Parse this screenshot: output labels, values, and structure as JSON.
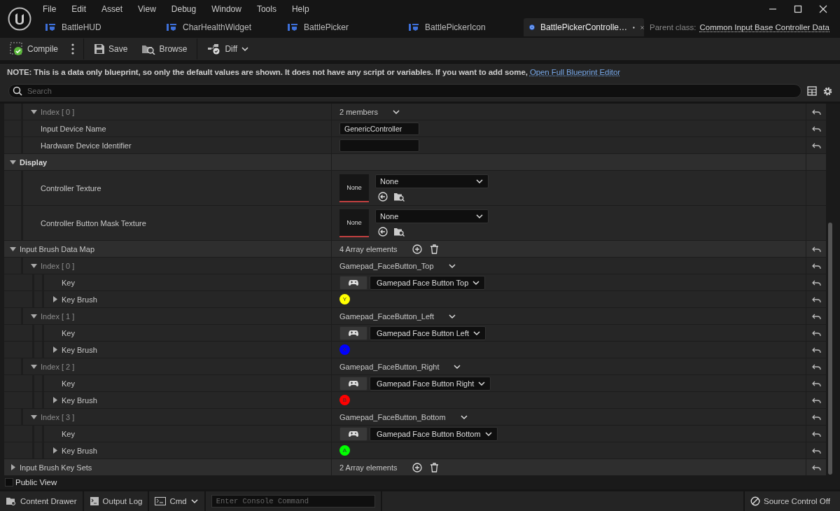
{
  "menu": [
    "File",
    "Edit",
    "Asset",
    "View",
    "Debug",
    "Window",
    "Tools",
    "Help"
  ],
  "tabs": [
    {
      "label": "BattleHUD",
      "kind": "widget",
      "selected": false,
      "modified": false
    },
    {
      "label": "CharHealthWidget",
      "kind": "widget",
      "selected": false,
      "modified": false
    },
    {
      "label": "BattlePicker",
      "kind": "widget",
      "selected": false,
      "modified": false
    },
    {
      "label": "BattlePickerIcon",
      "kind": "widget",
      "selected": false,
      "modified": false
    },
    {
      "label": "BattlePickerControlle…",
      "kind": "data",
      "selected": true,
      "modified": true
    }
  ],
  "parent_class": {
    "label": "Parent class:",
    "link": "Common Input Base Controller Data"
  },
  "toolbar": [
    {
      "kind": "compile",
      "label": "Compile"
    },
    {
      "kind": "more"
    },
    {
      "kind": "save",
      "label": "Save"
    },
    {
      "kind": "browse",
      "label": "Browse"
    },
    {
      "kind": "diff",
      "label": "Diff"
    }
  ],
  "notice": {
    "text": "NOTE: This is a data only blueprint, so only the default values are shown.  It does not have any script or variables.  If you want to add some, ",
    "link": "Open Full Blueprint Editor"
  },
  "search": {
    "placeholder": "Search"
  },
  "properties": [
    {
      "kind": "struct",
      "label": "Index [ 0 ]",
      "continues_above": true,
      "expanded": true,
      "value": "2 members",
      "resettable": true,
      "children": [
        {
          "kind": "text",
          "label": "Input Device Name",
          "value": "GenericController",
          "resettable": true
        },
        {
          "kind": "text",
          "label": "Hardware Device Identifier",
          "resettable": true
        }
      ]
    },
    {
      "kind": "category",
      "label": "Display",
      "expanded": true,
      "resettable": false,
      "children": [
        {
          "kind": "texture",
          "label": "Controller Texture",
          "thumbnail": "None",
          "value": "None",
          "resettable": false
        },
        {
          "kind": "texture",
          "label": "Controller Button Mask Texture",
          "thumbnail": "None",
          "value": "None",
          "resettable": false
        }
      ]
    },
    {
      "kind": "array",
      "label": "Input Brush Data Map",
      "expanded": true,
      "value": "4 Array elements",
      "resettable": true,
      "children": [
        {
          "kind": "struct",
          "label": "Index [ 0 ]",
          "expanded": true,
          "value": "Gamepad_FaceButton_Top",
          "resettable": true,
          "children": [
            {
              "kind": "key",
              "label": "Key",
              "value": "Gamepad Face Button Top",
              "resettable": true
            },
            {
              "kind": "brush",
              "label": "Key Brush",
              "expanded": false,
              "glyph": "Y",
              "color": "#ffff00",
              "resettable": true
            }
          ]
        },
        {
          "kind": "struct",
          "label": "Index [ 1 ]",
          "expanded": true,
          "value": "Gamepad_FaceButton_Left",
          "resettable": true,
          "children": [
            {
              "kind": "key",
              "label": "Key",
              "value": "Gamepad Face Button Left",
              "resettable": true
            },
            {
              "kind": "brush",
              "label": "Key Brush",
              "expanded": false,
              "glyph": "X",
              "color": "#0000ff",
              "resettable": true
            }
          ]
        },
        {
          "kind": "struct",
          "label": "Index [ 2 ]",
          "expanded": true,
          "value": "Gamepad_FaceButton_Right",
          "resettable": true,
          "children": [
            {
              "kind": "key",
              "label": "Key",
              "value": "Gamepad Face Button Right",
              "resettable": true
            },
            {
              "kind": "brush",
              "label": "Key Brush",
              "expanded": false,
              "glyph": "B",
              "color": "#ff0000",
              "resettable": true
            }
          ]
        },
        {
          "kind": "struct",
          "label": "Index [ 3 ]",
          "expanded": true,
          "value": "Gamepad_FaceButton_Bottom",
          "resettable": true,
          "children": [
            {
              "kind": "key",
              "label": "Key",
              "value": "Gamepad Face Button Bottom",
              "resettable": true
            },
            {
              "kind": "brush",
              "label": "Key Brush",
              "expanded": false,
              "glyph": "A",
              "color": "#00ff00",
              "resettable": true
            }
          ]
        }
      ]
    },
    {
      "kind": "array",
      "label": "Input Brush Key Sets",
      "expanded": false,
      "value": "2 Array elements",
      "resettable": true
    }
  ],
  "public_view": {
    "label": "Public View",
    "checked": false
  },
  "status_bar": {
    "content_drawer": "Content Drawer",
    "output_log": "Output Log",
    "cmd": "Cmd",
    "console_placeholder": "Enter Console Command",
    "source_control": "Source Control Off"
  }
}
